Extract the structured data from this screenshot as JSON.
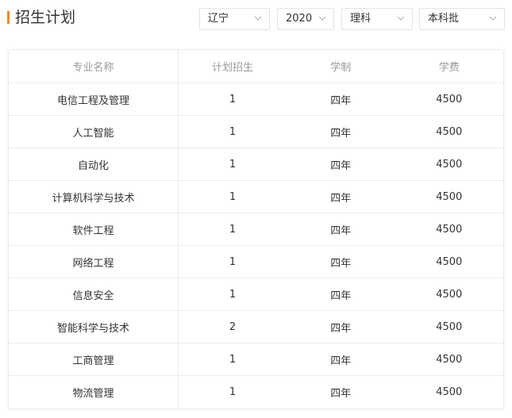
{
  "title": "招生计划",
  "colors": {
    "accent": "#f28a1f",
    "header_text": "#999999",
    "body_text": "#333333"
  },
  "filters": [
    {
      "selected": "辽宁",
      "icon": "chevron-down-icon"
    },
    {
      "selected": "2020",
      "icon": "chevron-down-icon"
    },
    {
      "selected": "理科",
      "icon": "chevron-down-icon"
    },
    {
      "selected": "本科批",
      "icon": "chevron-down-icon"
    }
  ],
  "table": {
    "columns": [
      "专业名称",
      "计划招生",
      "学制",
      "学费"
    ],
    "rows": [
      [
        "电信工程及管理",
        "1",
        "四年",
        "4500"
      ],
      [
        "人工智能",
        "1",
        "四年",
        "4500"
      ],
      [
        "自动化",
        "1",
        "四年",
        "4500"
      ],
      [
        "计算机科学与技术",
        "1",
        "四年",
        "4500"
      ],
      [
        "软件工程",
        "1",
        "四年",
        "4500"
      ],
      [
        "网络工程",
        "1",
        "四年",
        "4500"
      ],
      [
        "信息安全",
        "1",
        "四年",
        "4500"
      ],
      [
        "智能科学与技术",
        "2",
        "四年",
        "4500"
      ],
      [
        "工商管理",
        "1",
        "四年",
        "4500"
      ],
      [
        "物流管理",
        "1",
        "四年",
        "4500"
      ]
    ]
  }
}
